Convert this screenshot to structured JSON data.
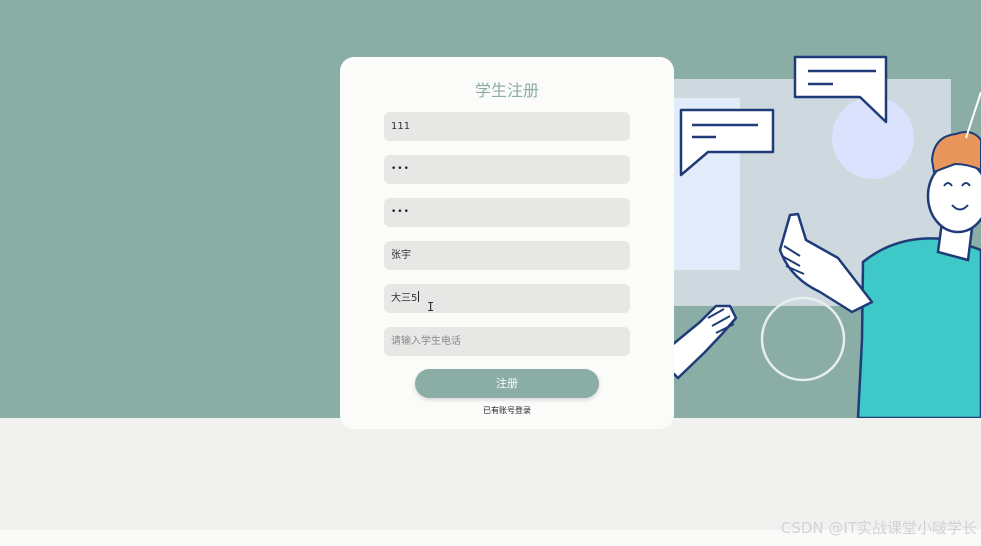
{
  "form": {
    "title": "学生注册",
    "fields": [
      {
        "name": "username",
        "value": "111",
        "placeholder": ""
      },
      {
        "name": "password",
        "value": "•••",
        "placeholder": ""
      },
      {
        "name": "confirm-password",
        "value": "•••",
        "placeholder": ""
      },
      {
        "name": "student-name",
        "value": "张宇",
        "placeholder": ""
      },
      {
        "name": "grade",
        "value": "大三5",
        "placeholder": ""
      },
      {
        "name": "phone",
        "value": "",
        "placeholder": "请输入学生电话"
      }
    ],
    "submit_label": "注册",
    "login_link": "已有账号登录"
  },
  "watermark": "CSDN @IT实战课堂小啵学长",
  "colors": {
    "hero_bg": "#8aada5",
    "accent": "#8aada5",
    "card_bg": "#fbfbf9",
    "field_bg": "#e7e7e6",
    "shirt": "#3ec8c8",
    "outline": "#1f3c78",
    "hair": "#e8965c"
  },
  "icons": {
    "text_cursor": "I"
  }
}
